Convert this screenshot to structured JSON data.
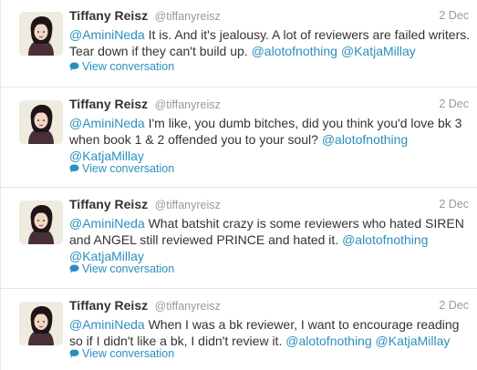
{
  "tweets": [
    {
      "fullname": "Tiffany Reisz",
      "username": "@tiffanyreisz",
      "time": "2 Dec",
      "segments": [
        {
          "text": "@AminiNeda",
          "link": true
        },
        {
          "text": " It is. And it's jealousy. A lot of reviewers are failed writers. Tear down if they can't build up. ",
          "link": false
        },
        {
          "text": "@alotofnothing",
          "link": true
        },
        {
          "text": " ",
          "link": false
        },
        {
          "text": "@KatjaMillay",
          "link": true
        }
      ],
      "action_label": "View conversation"
    },
    {
      "fullname": "Tiffany Reisz",
      "username": "@tiffanyreisz",
      "time": "2 Dec",
      "segments": [
        {
          "text": "@AminiNeda",
          "link": true
        },
        {
          "text": " I'm like, you dumb bitches, did you think you'd love bk 3 when book 1 & 2 offended you to your soul? ",
          "link": false
        },
        {
          "text": "@alotofnothing",
          "link": true
        },
        {
          "text": " ",
          "link": false
        },
        {
          "text": "@KatjaMillay",
          "link": true
        }
      ],
      "action_label": "View conversation"
    },
    {
      "fullname": "Tiffany Reisz",
      "username": "@tiffanyreisz",
      "time": "2 Dec",
      "segments": [
        {
          "text": "@AminiNeda",
          "link": true
        },
        {
          "text": " What batshit crazy is some reviewers who hated SIREN and ANGEL still reviewed PRINCE and hated it. ",
          "link": false
        },
        {
          "text": "@alotofnothing",
          "link": true
        },
        {
          "text": " ",
          "link": false
        },
        {
          "text": "@KatjaMillay",
          "link": true
        }
      ],
      "action_label": "View conversation"
    },
    {
      "fullname": "Tiffany Reisz",
      "username": "@tiffanyreisz",
      "time": "2 Dec",
      "segments": [
        {
          "text": "@AminiNeda",
          "link": true
        },
        {
          "text": " When I was a bk reviewer, I want to encourage reading so if I didn't like a bk, I didn't review it. ",
          "link": false
        },
        {
          "text": "@alotofnothing",
          "link": true
        },
        {
          "text": " ",
          "link": false
        },
        {
          "text": "@KatjaMillay",
          "link": true
        }
      ],
      "action_label": "View conversation"
    }
  ],
  "colors": {
    "link": "#2a8fbd",
    "name": "#333333",
    "meta": "#999999",
    "divider": "#e8e8e8"
  },
  "icons": {
    "avatar": "profile-photo-avatar",
    "conversation": "speech-bubble-icon"
  }
}
